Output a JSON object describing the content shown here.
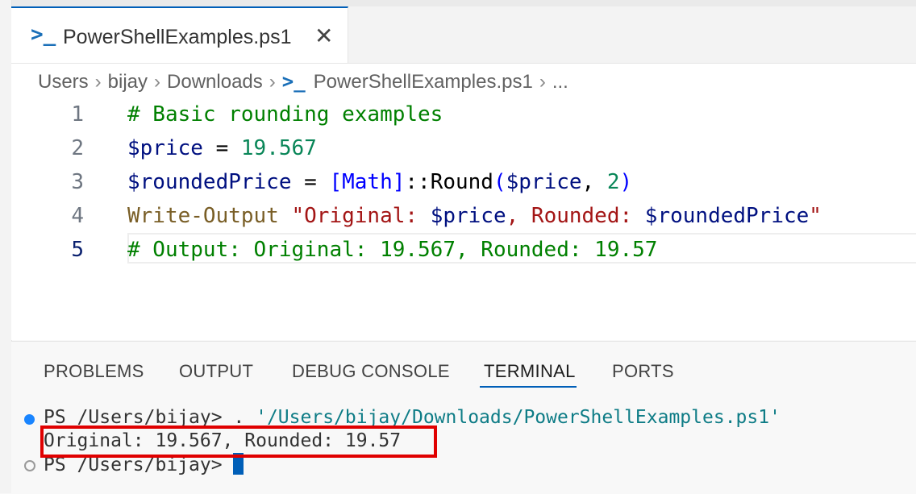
{
  "tab": {
    "icon": "powershell-icon",
    "title": "PowerShellExamples.ps1",
    "close": "✕"
  },
  "breadcrumb": [
    "Users",
    "bijay",
    "Downloads",
    "PowerShellExamples.ps1",
    "..."
  ],
  "code": {
    "line_numbers": [
      "1",
      "2",
      "3",
      "4",
      "5"
    ],
    "l1": "# Basic rounding examples",
    "l2": {
      "var": "$price",
      "op": " = ",
      "num": "19.567"
    },
    "l3": {
      "var": "$roundedPrice",
      "op": " = ",
      "type": "[Math]",
      "method": "::Round",
      "paren_open": "(",
      "arg": "$price",
      "comma": ", ",
      "num": "2",
      "paren_close": ")"
    },
    "l4": {
      "cmd": "Write-Output",
      "space": " ",
      "str1": "\"Original: ",
      "var1": "$price",
      "str2": ", Rounded: ",
      "var2": "$roundedPrice",
      "str3": "\""
    },
    "l5": "# Output: Original: 19.567, Rounded: 19.57"
  },
  "panel_tabs": [
    "PROBLEMS",
    "OUTPUT",
    "DEBUG CONSOLE",
    "TERMINAL",
    "PORTS"
  ],
  "active_panel_tab": "TERMINAL",
  "terminal": {
    "line1_prompt": "PS /Users/bijay> . ",
    "line1_path": "'/Users/bijay/Downloads/PowerShellExamples.ps1'",
    "line2": "Original: 19.567, Rounded: 19.57",
    "line3_prompt": "PS /Users/bijay> "
  },
  "colors": {
    "accent": "#005fb8",
    "highlight_box": "#e00000"
  }
}
